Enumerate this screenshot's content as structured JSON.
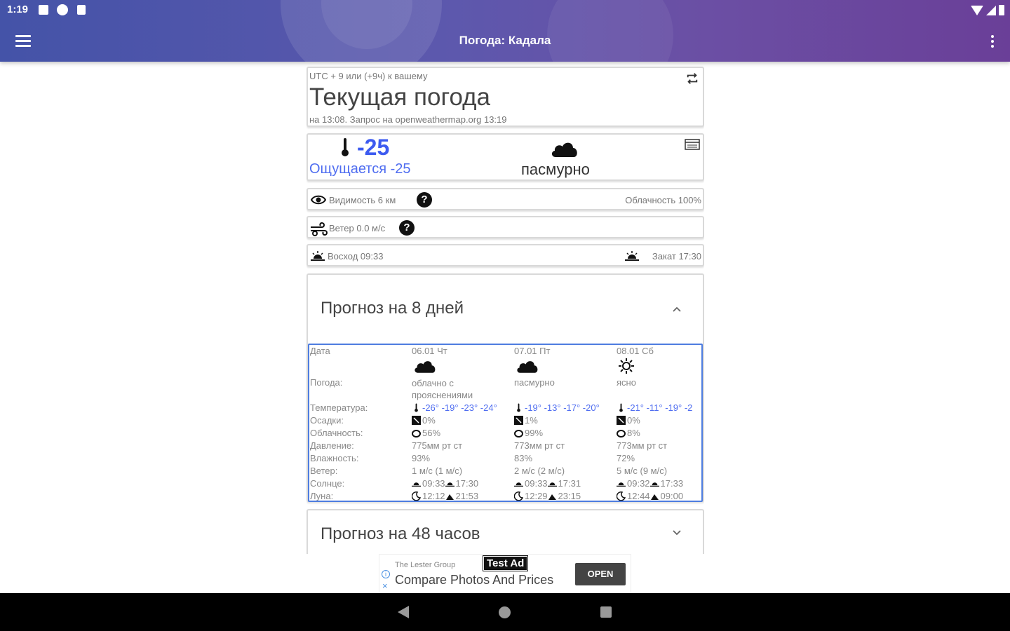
{
  "status": {
    "time": "1:19"
  },
  "appbar": {
    "title": "Погода: Кадала"
  },
  "current": {
    "timezone": "UTC + 9 или (+9ч) к вашему",
    "title": "Текущая погода",
    "subtitle": "на 13:08. Запрос на openweathermap.org 13:19",
    "temperature": "-25",
    "feels_like": "Ощущается -25",
    "condition": "пасмурно",
    "visibility": "Видимость 6  км",
    "cloudiness": "Облачность 100%",
    "wind": "Ветер 0.0 м/с",
    "sunrise": "Восход 09:33",
    "sunset": "Закат 17:30",
    "help_glyph": "?"
  },
  "forecast8": {
    "title": "Прогноз на 8 дней",
    "labels": {
      "date": "Дата",
      "weather": "Погода:",
      "temperature": "Температура:",
      "precipitation": "Осадки:",
      "cloudiness": "Облачность:",
      "pressure": "Давление:",
      "humidity": "Влажность:",
      "wind": "Ветер:",
      "sun": "Солнце:",
      "moon": "Луна:"
    },
    "days": [
      {
        "date": "06.01 Чт",
        "icon": "cloud-icon",
        "weather": "облачно с прояснениями",
        "temps": "-26° -19° -23° -24°",
        "precip": "0%",
        "cloud": "56%",
        "pressure": "775мм рт ст",
        "humidity": "93%",
        "wind": "1 м/с (1 м/с)",
        "sun_rise": "09:33",
        "sun_set": "17:30",
        "moon_rise": "12:12",
        "moon_set": "21:53"
      },
      {
        "date": "07.01 Пт",
        "icon": "cloud-icon",
        "weather": "пасмурно",
        "temps": "-19° -13° -17° -20°",
        "precip": "1%",
        "cloud": "99%",
        "pressure": "773мм рт ст",
        "humidity": "83%",
        "wind": "2 м/с (2 м/с)",
        "sun_rise": "09:33",
        "sun_set": "17:31",
        "moon_rise": "12:29",
        "moon_set": "23:15"
      },
      {
        "date": "08.01 Сб",
        "icon": "sun-icon",
        "weather": "ясно",
        "temps": "-21° -11° -19° -2",
        "precip": "0%",
        "cloud": "8%",
        "pressure": "773мм рт ст",
        "humidity": "72%",
        "wind": "5 м/с (9 м/с)",
        "sun_rise": "09:32",
        "sun_set": "17:33",
        "moon_rise": "12:44",
        "moon_set": "09:00"
      }
    ]
  },
  "forecast48": {
    "title": "Прогноз на 48 часов"
  },
  "ad": {
    "badge": "Test Ad",
    "advertiser": "The Lester Group",
    "text": "Compare Photos And Prices",
    "button": "OPEN",
    "info_glyph": "i",
    "close_glyph": "×"
  },
  "colors": {
    "accent_blue": "#3d5bf0",
    "appbar_start": "#4453a8",
    "appbar_end": "#6a3f98",
    "table_border": "#4e7de0"
  }
}
